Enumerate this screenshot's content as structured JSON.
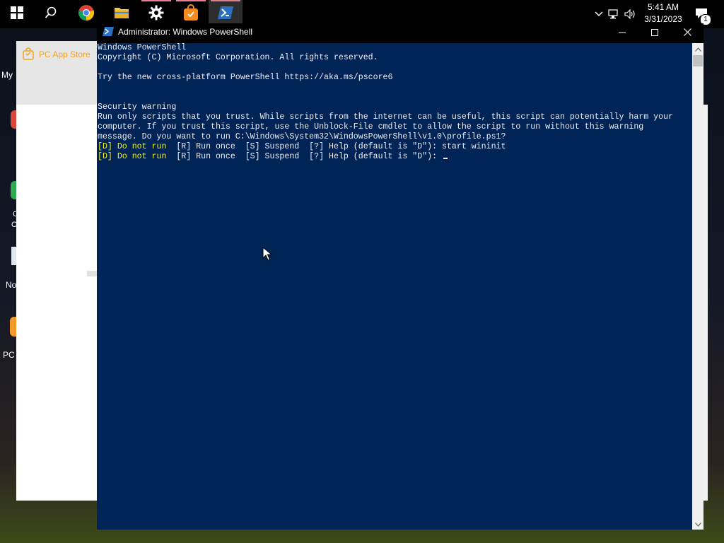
{
  "taskbar": {
    "items": [
      {
        "name": "start-button",
        "icon": "windows-logo-icon"
      },
      {
        "name": "search-button",
        "icon": "search-icon"
      },
      {
        "name": "chrome",
        "icon": "chrome-icon"
      },
      {
        "name": "file-explorer",
        "icon": "folder-icon"
      },
      {
        "name": "settings",
        "icon": "gear-icon"
      },
      {
        "name": "pc-app-store",
        "icon": "shopping-bag-icon"
      },
      {
        "name": "powershell",
        "icon": "powershell-icon"
      }
    ],
    "clock_time": "5:41 AM",
    "clock_date": "3/31/2023",
    "notification_count": "1"
  },
  "desktop": {
    "fragment_my": "My",
    "fragment_no": "No",
    "fragment_pc": "PC",
    "fragment_c1": "C",
    "fragment_c2": "C"
  },
  "background_app": {
    "title": "PC App Store",
    "accent": "#f0a020"
  },
  "powershell": {
    "title": "Administrator: Windows PowerShell",
    "background": "#012456",
    "lines": [
      {
        "text": "Windows PowerShell",
        "color": "default"
      },
      {
        "text": "Copyright (C) Microsoft Corporation. All rights reserved.",
        "color": "default"
      },
      {
        "text": "",
        "color": "default"
      },
      {
        "text": "Try the new cross-platform PowerShell https://aka.ms/pscore6",
        "color": "default"
      },
      {
        "text": "",
        "color": "default"
      },
      {
        "text": "",
        "color": "default"
      },
      {
        "text": "Security warning",
        "color": "default"
      },
      {
        "text": "Run only scripts that you trust. While scripts from the internet can be useful, this script can potentially harm your",
        "color": "default"
      },
      {
        "text": "computer. If you trust this script, use the Unblock-File cmdlet to allow the script to run without this warning",
        "color": "default"
      },
      {
        "text": "message. Do you want to run C:\\Windows\\System32\\WindowsPowerShell\\v1.0\\profile.ps1?",
        "color": "default"
      }
    ],
    "prompt_lines": [
      {
        "default_choice": "[D] Do not run",
        "rest": "  [R] Run once  [S] Suspend  [?] Help (default is \"D\"): start wininit"
      },
      {
        "default_choice": "[D] Do not run",
        "rest": "  [R] Run once  [S] Suspend  [?] Help (default is \"D\"): "
      }
    ]
  }
}
